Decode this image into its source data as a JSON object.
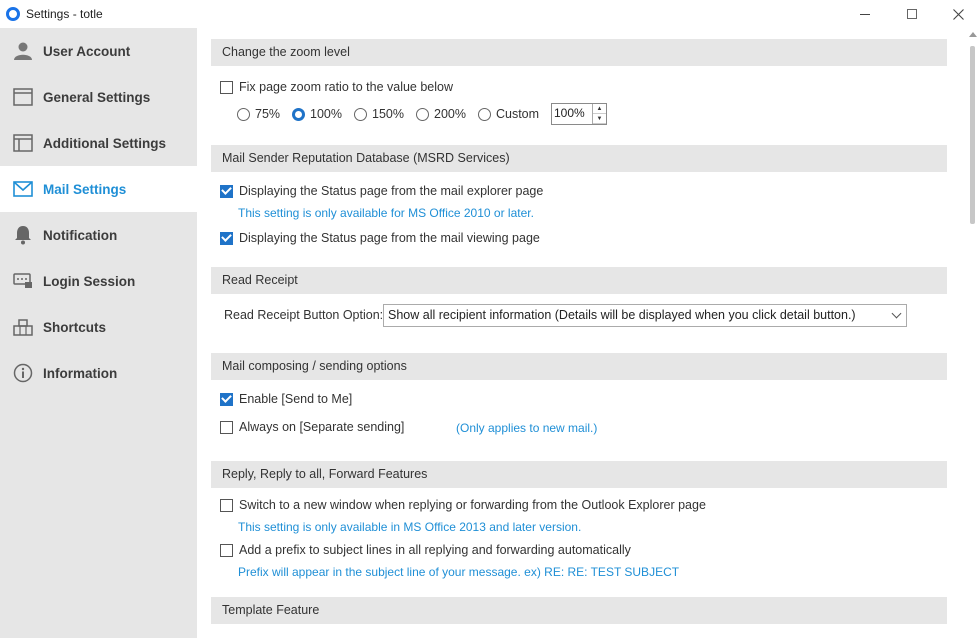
{
  "window": {
    "title": "Settings - totle"
  },
  "sidebar": {
    "items": [
      {
        "label": "User Account",
        "icon": "user-icon"
      },
      {
        "label": "General Settings",
        "icon": "window-icon"
      },
      {
        "label": "Additional Settings",
        "icon": "panel-icon"
      },
      {
        "label": "Mail Settings",
        "icon": "mail-icon",
        "active": true
      },
      {
        "label": "Notification",
        "icon": "bell-icon"
      },
      {
        "label": "Login Session",
        "icon": "session-icon"
      },
      {
        "label": "Shortcuts",
        "icon": "shortcut-icon"
      },
      {
        "label": "Information",
        "icon": "info-icon"
      }
    ]
  },
  "zoom": {
    "header": "Change the zoom level",
    "fix_label": "Fix page zoom ratio to the value below",
    "fix_checked": false,
    "options": [
      "75%",
      "100%",
      "150%",
      "200%",
      "Custom"
    ],
    "selected": "100%",
    "custom_value": "100%"
  },
  "msrd": {
    "header": "Mail Sender Reputation Database (MSRD Services)",
    "explorer_label": "Displaying the Status page from the mail explorer page",
    "explorer_note": "This setting is only available for MS Office 2010 or later.",
    "viewing_label": "Displaying the Status page from the mail viewing page"
  },
  "receipt": {
    "header": "Read Receipt",
    "label": "Read Receipt Button Option:",
    "value": "Show all recipient information (Details will be displayed when you click detail button.)"
  },
  "composing": {
    "header": "Mail composing / sending options",
    "send_to_me": "Enable [Send to Me]",
    "separate": "Always on [Separate sending]",
    "separate_note": "(Only applies to new mail.)"
  },
  "reply": {
    "header": "Reply, Reply to all, Forward Features",
    "new_window": "Switch to a new window when replying or forwarding from the Outlook Explorer page",
    "new_window_note": "This setting is only available in MS Office 2013 and later version.",
    "prefix": "Add a prefix to subject lines in all replying and forwarding automatically",
    "prefix_note": "Prefix will appear in the subject line of your message. ex) RE: RE: TEST SUBJECT"
  },
  "template": {
    "header": "Template Feature"
  },
  "colors": {
    "accent": "#1f8fd6",
    "checkbox": "#1f73c8",
    "sidebar_bg": "#e6e6e6",
    "header_bg": "#e6e6e6"
  }
}
